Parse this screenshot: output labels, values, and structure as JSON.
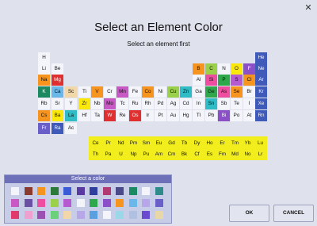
{
  "window": {
    "close_glyph": "✕"
  },
  "title": "Select an Element Color",
  "subtitle": "Select an element first",
  "elements": [
    {
      "s": "H",
      "c": "#f4f5fb"
    },
    {
      "s": "He",
      "c": "#3f5ab8"
    },
    {
      "s": "Li",
      "c": "#f4f5fb"
    },
    {
      "s": "Be",
      "c": "#f4f5fb"
    },
    {
      "s": "B",
      "c": "#f7941d"
    },
    {
      "s": "C",
      "c": "#9bd04a"
    },
    {
      "s": "N",
      "c": "#f4f5fb"
    },
    {
      "s": "O",
      "c": "#fbe80b"
    },
    {
      "s": "F",
      "c": "#8b4fc7"
    },
    {
      "s": "Ne",
      "c": "#3f5ab8"
    },
    {
      "s": "Na",
      "c": "#f7941d"
    },
    {
      "s": "Mg",
      "c": "#e02f2f"
    },
    {
      "s": "Al",
      "c": "#f4f5fb"
    },
    {
      "s": "Si",
      "c": "#ee4da0"
    },
    {
      "s": "P",
      "c": "#2ea84a"
    },
    {
      "s": "S",
      "c": "#b55ad1"
    },
    {
      "s": "Cl",
      "c": "#f7941d"
    },
    {
      "s": "Ar",
      "c": "#3f5ab8"
    },
    {
      "s": "K",
      "c": "#1b8a63"
    },
    {
      "s": "Ca",
      "c": "#6ab8ea"
    },
    {
      "s": "Sc",
      "c": "#f2d7a8"
    },
    {
      "s": "Ti",
      "c": "#f4f5fb"
    },
    {
      "s": "V",
      "c": "#f7941d"
    },
    {
      "s": "Cr",
      "c": "#f4f5fb"
    },
    {
      "s": "Mn",
      "c": "#c858c4"
    },
    {
      "s": "Fe",
      "c": "#f4f5fb"
    },
    {
      "s": "Co",
      "c": "#f7941d"
    },
    {
      "s": "Ni",
      "c": "#f4f5fb"
    },
    {
      "s": "Cu",
      "c": "#9bd04a"
    },
    {
      "s": "Zn",
      "c": "#2fbcc4"
    },
    {
      "s": "Ga",
      "c": "#f4f5fb"
    },
    {
      "s": "Ge",
      "c": "#2ea84a"
    },
    {
      "s": "As",
      "c": "#ee4da0"
    },
    {
      "s": "Se",
      "c": "#f7941d"
    },
    {
      "s": "Br",
      "c": "#f4f5fb"
    },
    {
      "s": "Kr",
      "c": "#3f5ab8"
    },
    {
      "s": "Rb",
      "c": "#f4f5fb"
    },
    {
      "s": "Sr",
      "c": "#f4f5fb"
    },
    {
      "s": "Y",
      "c": "#f4f5fb"
    },
    {
      "s": "Zr",
      "c": "#fbe80b"
    },
    {
      "s": "Nb",
      "c": "#f4f5fb"
    },
    {
      "s": "Mo",
      "c": "#c858c4"
    },
    {
      "s": "Tc",
      "c": "#f4f5fb"
    },
    {
      "s": "Ru",
      "c": "#f4f5fb"
    },
    {
      "s": "Rh",
      "c": "#f4f5fb"
    },
    {
      "s": "Pd",
      "c": "#f4f5fb"
    },
    {
      "s": "Ag",
      "c": "#f4f5fb"
    },
    {
      "s": "Cd",
      "c": "#f4f5fb"
    },
    {
      "s": "In",
      "c": "#f4f5fb"
    },
    {
      "s": "Sn",
      "c": "#2fbcc4"
    },
    {
      "s": "Sb",
      "c": "#f4f5fb"
    },
    {
      "s": "Te",
      "c": "#f4f5fb"
    },
    {
      "s": "I",
      "c": "#f4f5fb"
    },
    {
      "s": "Xe",
      "c": "#3f5ab8"
    },
    {
      "s": "Cs",
      "c": "#f7941d"
    },
    {
      "s": "Ba",
      "c": "#fbe80b"
    },
    {
      "s": "La",
      "c": "#2fbcc4"
    },
    {
      "s": "Hf",
      "c": "#f4f5fb"
    },
    {
      "s": "Ta",
      "c": "#f4f5fb"
    },
    {
      "s": "W",
      "c": "#e02f2f"
    },
    {
      "s": "Re",
      "c": "#f4f5fb"
    },
    {
      "s": "Os",
      "c": "#e02f2f"
    },
    {
      "s": "Ir",
      "c": "#f4f5fb"
    },
    {
      "s": "Pt",
      "c": "#f4f5fb"
    },
    {
      "s": "Au",
      "c": "#f4f5fb"
    },
    {
      "s": "Hg",
      "c": "#f4f5fb"
    },
    {
      "s": "Tl",
      "c": "#f4f5fb"
    },
    {
      "s": "Pb",
      "c": "#f4f5fb"
    },
    {
      "s": "Bi",
      "c": "#8b4fc7"
    },
    {
      "s": "Po",
      "c": "#f4f5fb"
    },
    {
      "s": "At",
      "c": "#f4f5fb"
    },
    {
      "s": "Rn",
      "c": "#3f5ab8"
    },
    {
      "s": "Fr",
      "c": "#6a5fc9"
    },
    {
      "s": "Ra",
      "c": "#3f5ab8"
    },
    {
      "s": "Ac",
      "c": "#f4f5fb"
    },
    {
      "s": "Ce",
      "c": "#f2ee1e"
    },
    {
      "s": "Pr",
      "c": "#f2ee1e"
    },
    {
      "s": "Nd",
      "c": "#f2ee1e"
    },
    {
      "s": "Pm",
      "c": "#f2ee1e"
    },
    {
      "s": "Sm",
      "c": "#f2ee1e"
    },
    {
      "s": "Eu",
      "c": "#f2ee1e"
    },
    {
      "s": "Gd",
      "c": "#f2ee1e"
    },
    {
      "s": "Tb",
      "c": "#f2ee1e"
    },
    {
      "s": "Dy",
      "c": "#f2ee1e"
    },
    {
      "s": "Ho",
      "c": "#f2ee1e"
    },
    {
      "s": "Er",
      "c": "#f2ee1e"
    },
    {
      "s": "Tm",
      "c": "#f2ee1e"
    },
    {
      "s": "Yb",
      "c": "#f2ee1e"
    },
    {
      "s": "Lu",
      "c": "#f2ee1e"
    },
    {
      "s": "Th",
      "c": "#f2ee1e"
    },
    {
      "s": "Pa",
      "c": "#f2ee1e"
    },
    {
      "s": "U",
      "c": "#f2ee1e"
    },
    {
      "s": "Np",
      "c": "#f2ee1e"
    },
    {
      "s": "Pu",
      "c": "#f2ee1e"
    },
    {
      "s": "Am",
      "c": "#f2ee1e"
    },
    {
      "s": "Cm",
      "c": "#f2ee1e"
    },
    {
      "s": "Bk",
      "c": "#f2ee1e"
    },
    {
      "s": "Cf",
      "c": "#f2ee1e"
    },
    {
      "s": "Es",
      "c": "#f2ee1e"
    },
    {
      "s": "Fm",
      "c": "#f2ee1e"
    },
    {
      "s": "Md",
      "c": "#f2ee1e"
    },
    {
      "s": "No",
      "c": "#f2ee1e"
    },
    {
      "s": "Lr",
      "c": "#f2ee1e"
    }
  ],
  "palette": {
    "title": "Select a color",
    "colors": [
      "#f4f5fb",
      "#8b3a2e",
      "#f7941d",
      "#2b7a3a",
      "#3b5bd6",
      "#5a3aa0",
      "#2e3f9e",
      "#b23a72",
      "#4a4a8a",
      "#1b8a63",
      "#f4f5fb",
      "#2f8a8a",
      "#3f5ab8",
      "#6a5fc9",
      "#3a2a6e",
      "#7e7e86",
      "#9aa0c8",
      "#d23a3a",
      "#5a4fb0",
      "#2a6ed0",
      "#c858c4",
      "#6b4fa3",
      "#ee4da0",
      "#9bd04a",
      "#b55ad1",
      "#f4f5fb",
      "#2ea84a",
      "#8b4fc7",
      "#f7941d",
      "#6ab8ea",
      "#b7a7e8",
      "#6a5fc9",
      "#b53ae0",
      "#2fbcc4",
      "#f4f5fb",
      "#f4f5fb",
      "#8b6a3a",
      "#f5c7a0",
      "#b8b8d8",
      "#2b3a7a",
      "#e03a6a",
      "#f0a0d0",
      "#9b4fb0",
      "#6bd07a",
      "#f2d7a8",
      "#b7a7e8",
      "#5aa0e0",
      "#f4f5fb",
      "#9ad8e8",
      "#b0c0e0",
      "#6a4ad0",
      "#e8d8a8",
      "#f7941d",
      "#fbe80b",
      "#c0c0d0",
      "#2fbcc4",
      "#f4f5fb",
      "#c8a0e0",
      "#e02f2f",
      "#7a9ad8"
    ]
  },
  "buttons": {
    "ok": "OK",
    "cancel": "CANCEL"
  }
}
